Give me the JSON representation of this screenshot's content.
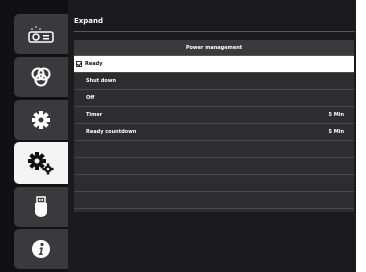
{
  "panel": {
    "title": "Expand"
  },
  "table": {
    "header": "Power management",
    "rows": [
      {
        "label": "Ready",
        "value": "",
        "selected": true
      },
      {
        "label": "Shut down",
        "value": ""
      },
      {
        "label": "Off",
        "value": ""
      },
      {
        "label": "Timer",
        "value": "5  Min"
      },
      {
        "label": "Ready countdown",
        "value": "5  Min"
      }
    ]
  },
  "sidebar": {
    "items": [
      {
        "icon": "projector-icon"
      },
      {
        "icon": "color-circles-icon"
      },
      {
        "icon": "gear-icon"
      },
      {
        "icon": "gears-icon",
        "active": true
      },
      {
        "icon": "usb-icon"
      },
      {
        "icon": "info-icon"
      }
    ]
  },
  "colors": {
    "background": "#1b1b1d",
    "selected_row": "#ffffff",
    "sidebar_button": "#3a3a3c"
  }
}
